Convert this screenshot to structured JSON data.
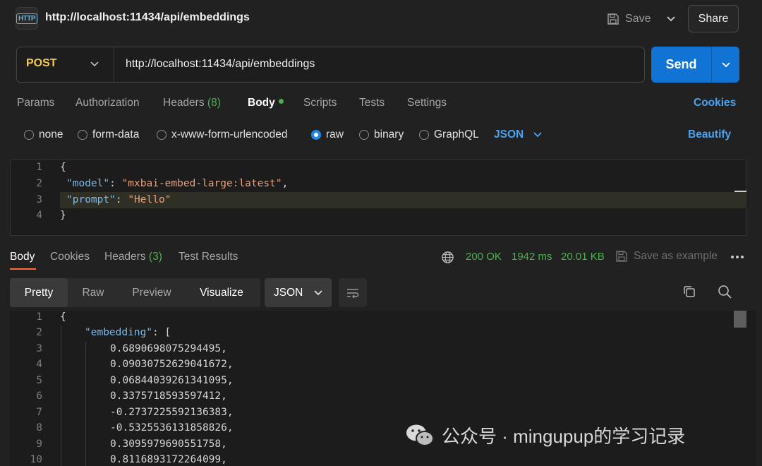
{
  "header": {
    "tab_title": "http://localhost:11434/api/embeddings",
    "save_label": "Save",
    "share_label": "Share",
    "icon": "http-file-icon"
  },
  "request": {
    "method": "POST",
    "url": "http://localhost:11434/api/embeddings",
    "send_label": "Send"
  },
  "request_tabs": {
    "params": "Params",
    "authorization": "Authorization",
    "headers": "Headers",
    "headers_count": "(8)",
    "body": "Body",
    "scripts": "Scripts",
    "tests": "Tests",
    "settings": "Settings",
    "cookies": "Cookies",
    "active": "Body"
  },
  "body_types": {
    "none": "none",
    "form_data": "form-data",
    "urlencoded": "x-www-form-urlencoded",
    "raw": "raw",
    "binary": "binary",
    "graphql": "GraphQL",
    "selected": "raw",
    "format": "JSON",
    "beautify": "Beautify"
  },
  "request_body": {
    "line_numbers": [
      "1",
      "2",
      "3",
      "4"
    ],
    "open_brace": "{",
    "model_key": "\"model\"",
    "model_value": "\"mxbai-embed-large:latest\"",
    "prompt_key": "\"prompt\"",
    "prompt_value": "\"Hello\"",
    "close_brace": "}",
    "colon": ":",
    "comma": ","
  },
  "response": {
    "tabs": {
      "body": "Body",
      "cookies": "Cookies",
      "headers": "Headers",
      "headers_count": "(3)",
      "test_results": "Test Results"
    },
    "status": "200 OK",
    "time": "1942 ms",
    "size": "20.01 KB",
    "save_example": "Save as example",
    "views": {
      "pretty": "Pretty",
      "raw": "Raw",
      "preview": "Preview",
      "visualize": "Visualize",
      "active": "Pretty"
    },
    "format": "JSON",
    "line_numbers": [
      "1",
      "2",
      "3",
      "4",
      "5",
      "6",
      "7",
      "8",
      "9",
      "10"
    ],
    "open_brace": "{",
    "embedding_key": "\"embedding\"",
    "array_open": "[",
    "values": [
      "0.6890698075294495,",
      "0.09030752629041672,",
      "0.06844039261341095,",
      "0.3375718593597412,",
      "-0.2737225592136383,",
      "-0.5325536131858826,",
      "0.3095979690551758,",
      "0.8116893172264099,"
    ]
  },
  "watermark": {
    "text": "公众号 · mingupup的学习记录",
    "icon": "wechat-icon"
  },
  "colors": {
    "background": "#212121",
    "accent_blue": "#1173d4",
    "link_blue": "#4aa3f0",
    "method_yellow": "#f2c94c",
    "status_green": "#4caf50",
    "json_key": "#7fb9e6",
    "json_string": "#e8a07a"
  }
}
